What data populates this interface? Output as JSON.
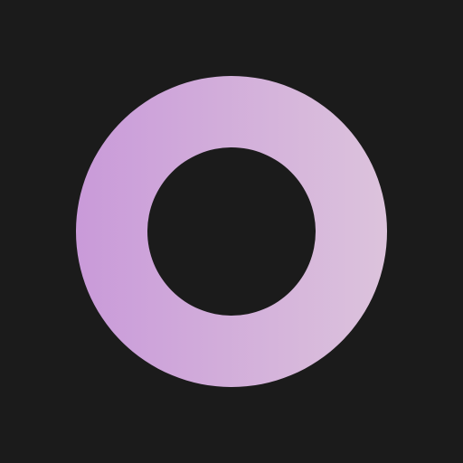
{
  "background_color": "#1b1b1b",
  "ring": {
    "icon": "ring-icon",
    "gradient_start_color": "#c99ad9",
    "gradient_end_color": "#dcc3dc"
  }
}
